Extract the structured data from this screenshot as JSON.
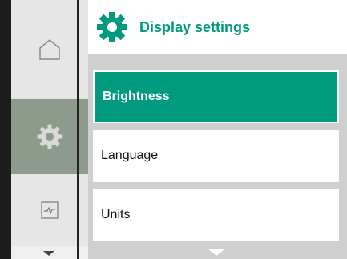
{
  "header": {
    "title": "Display settings",
    "icon": "gear-icon",
    "accent_color": "#009a7f"
  },
  "sidebar": {
    "items": [
      {
        "icon": "home-icon",
        "selected": false
      },
      {
        "icon": "gear-icon",
        "selected": true
      },
      {
        "icon": "monitor-graph-icon",
        "selected": false
      }
    ]
  },
  "menu": {
    "items": [
      {
        "label": "Brightness",
        "selected": true
      },
      {
        "label": "Language",
        "selected": false
      },
      {
        "label": "Units",
        "selected": false
      }
    ]
  }
}
